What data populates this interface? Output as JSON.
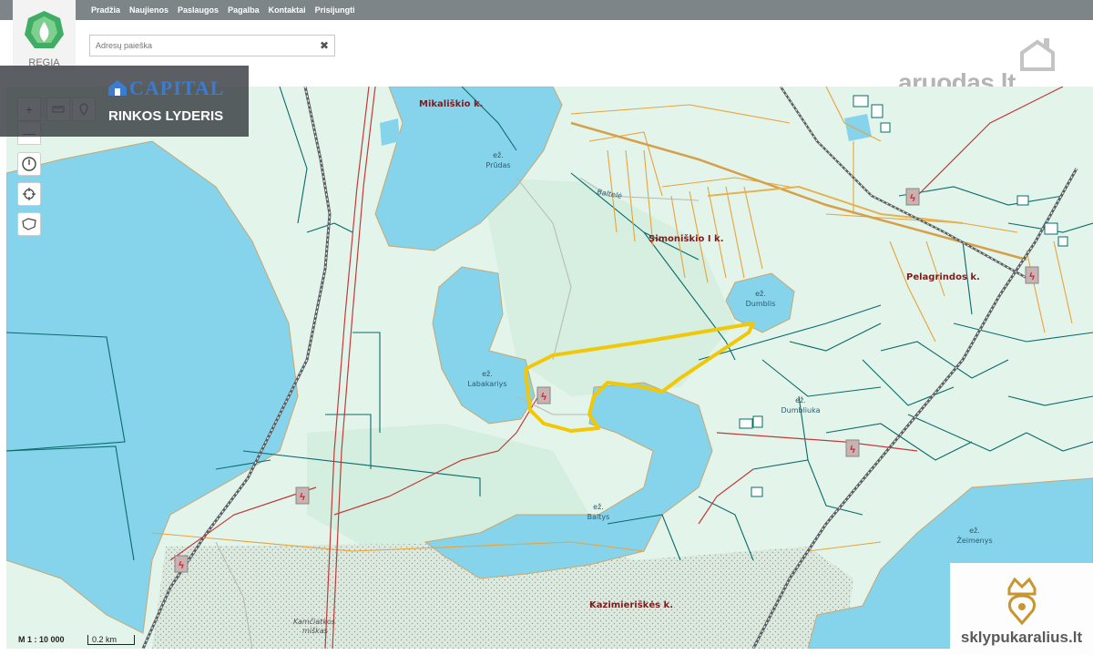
{
  "nav": {
    "items": [
      "Pradžia",
      "Naujienos",
      "Paslaugos",
      "Pagalba",
      "Kontaktai",
      "Prisijungti"
    ]
  },
  "logo": {
    "text": "REGIA"
  },
  "search": {
    "placeholder": "Adresų paieška",
    "clear": "✖"
  },
  "aruodas": {
    "text": "aruodas.lt"
  },
  "ad": {
    "brand": "CAPITAL",
    "tagline": "RINKOS LYDERIS"
  },
  "tools": {
    "zoom_in": "+",
    "zoom_out": "—"
  },
  "map": {
    "place_labels": [
      "Mikališkio k.",
      "Simoniškio I k.",
      "Pelagrindos k.",
      "Kazimieriškės k."
    ],
    "lake_labels": [
      {
        "prefix": "ež.",
        "name": "Prūdas"
      },
      {
        "prefix": "ež.",
        "name": "Dumblis"
      },
      {
        "prefix": "ež.",
        "name": "Labakariys"
      },
      {
        "prefix": "ež.",
        "name": "Dumbliuka"
      },
      {
        "prefix": "ež.",
        "name": "Baltys"
      },
      {
        "prefix": "ež.",
        "name": "Žeimenys"
      }
    ],
    "other_labels": [
      "Baltelė",
      "Kamčiatkos",
      "miškas"
    ],
    "colors": {
      "water": "#86d3ec",
      "forest": "#d9f2e4",
      "land": "#e6f5ec",
      "parcel": "#0a6b6b",
      "highlight": "#f0c808",
      "road": "#e8a33a"
    }
  },
  "scale": {
    "ratio": "M 1 : 10 000",
    "bar": "0.2 km"
  },
  "badge": {
    "text": "sklypukaralius.lt"
  }
}
